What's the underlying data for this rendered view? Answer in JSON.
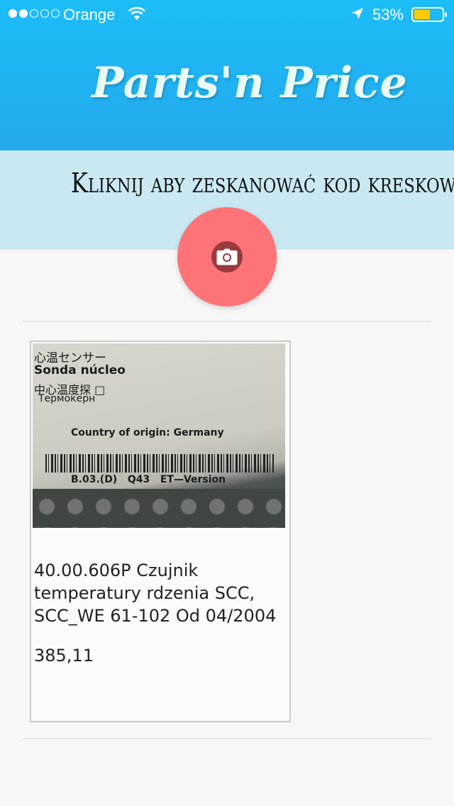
{
  "status_bar": {
    "carrier": "Orange",
    "battery_pct": "53%",
    "battery_level": 0.53,
    "signal_bars_filled": 2,
    "signal_bars_total": 5
  },
  "header": {
    "title": "Parts'n Price",
    "color": "#1cbdf9"
  },
  "scan": {
    "label": "Kliknij aby zeskanować kod kreskowy",
    "button_icon": "camera-icon",
    "button_color": "#fd7377"
  },
  "results": [
    {
      "photo": {
        "lines": [
          "心温センサー",
          "Sonda núcleo",
          "中心温度探 □",
          "Термокерн",
          "Country of origin: Germany",
          "B.03.(D)   Q43   ET—Version"
        ]
      },
      "name": "40.00.606P Czujnik temperatury rdzenia SCC, SCC_WE 61-102 Od 04/2004",
      "price": "385,11"
    }
  ]
}
